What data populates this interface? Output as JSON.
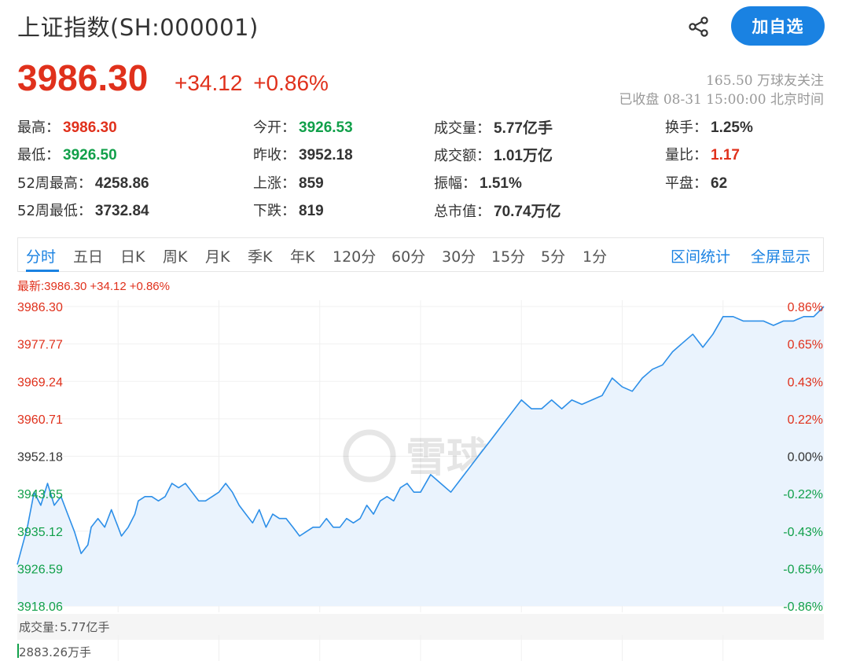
{
  "header": {
    "title": "上证指数(SH:000001)",
    "follow_button": "加自选",
    "share_icon": "share-icon"
  },
  "quote": {
    "price": "3986.30",
    "change": "+34.12",
    "change_pct": "+0.86%",
    "followers": "165.50 万球友关注",
    "status": "已收盘 08-31 15:00:00 北京时间"
  },
  "stats": [
    {
      "label": "最高：",
      "value": "3986.30",
      "color": "up"
    },
    {
      "label": "今开：",
      "value": "3926.53",
      "color": "down"
    },
    {
      "label": "成交量：",
      "value": "5.77亿手",
      "color": ""
    },
    {
      "label": "换手：",
      "value": "1.25%",
      "color": ""
    },
    {
      "label": "最低：",
      "value": "3926.50",
      "color": "down"
    },
    {
      "label": "昨收：",
      "value": "3952.18",
      "color": ""
    },
    {
      "label": "成交额：",
      "value": "1.01万亿",
      "color": ""
    },
    {
      "label": "量比：",
      "value": "1.17",
      "color": "up"
    },
    {
      "label": "52周最高：",
      "value": "4258.86",
      "color": ""
    },
    {
      "label": "上涨：",
      "value": "859",
      "color": ""
    },
    {
      "label": "振幅：",
      "value": "1.51%",
      "color": ""
    },
    {
      "label": "平盘：",
      "value": "62",
      "color": ""
    },
    {
      "label": "52周最低：",
      "value": "3732.84",
      "color": ""
    },
    {
      "label": "下跌：",
      "value": "819",
      "color": ""
    },
    {
      "label": "总市值：",
      "value": "70.74万亿",
      "color": ""
    }
  ],
  "tabs": [
    "分时",
    "五日",
    "日K",
    "周K",
    "月K",
    "季K",
    "年K",
    "120分",
    "60分",
    "30分",
    "15分",
    "5分",
    "1分"
  ],
  "tabs_right": [
    "区间统计",
    "全屏显示"
  ],
  "latest": {
    "label": "最新:3986.30",
    "change": "+34.12",
    "pct": "+0.86%"
  },
  "volume": {
    "label": "成交量:",
    "value": "5.77亿手",
    "max": "2883.26万手"
  },
  "colors": {
    "up": "#e0311c",
    "down": "#11a04a",
    "accent": "#1a82e2",
    "line": "#2d8fe8",
    "fill": "#eaf3fd"
  },
  "watermark": "雪球",
  "chart_data": {
    "type": "line",
    "prev_close": 3952.18,
    "ylim": [
      3918.06,
      3986.3
    ],
    "y_ticks_left": [
      "3986.30",
      "3977.77",
      "3969.24",
      "3960.71",
      "3952.18",
      "3943.65",
      "3935.12",
      "3926.59",
      "3918.06"
    ],
    "y_ticks_right": [
      "0.86%",
      "0.65%",
      "0.43%",
      "0.22%",
      "0.00%",
      "-0.22%",
      "-0.43%",
      "-0.65%",
      "-0.86%"
    ],
    "x_range": [
      0,
      240
    ],
    "grid": true,
    "series": [
      {
        "x": [
          0,
          3,
          5,
          7,
          9,
          11,
          13,
          15,
          17,
          19,
          21,
          22,
          24,
          26,
          28,
          30,
          31,
          33,
          35,
          36,
          38,
          40,
          42,
          44,
          46,
          48,
          50,
          52,
          54,
          56,
          58,
          60,
          62,
          64,
          66,
          68,
          70,
          72,
          74,
          76,
          78,
          80,
          82,
          84,
          86,
          88,
          90,
          92,
          94,
          96,
          98,
          100,
          102,
          104,
          106,
          108,
          110,
          112,
          114,
          116,
          118,
          120,
          123,
          126,
          129,
          132,
          135,
          138,
          141,
          144,
          147,
          150,
          153,
          156,
          159,
          162,
          165,
          168,
          171,
          174,
          177,
          180,
          183,
          186,
          189,
          192,
          195,
          198,
          201,
          204,
          207,
          210,
          213,
          216,
          219,
          222,
          225,
          228,
          231,
          234,
          237,
          240
        ],
        "y": [
          3927.5,
          3936,
          3944,
          3941,
          3946,
          3941,
          3943,
          3939,
          3935,
          3930,
          3932,
          3936,
          3938,
          3936,
          3940,
          3936,
          3934,
          3936,
          3939,
          3942,
          3943,
          3943,
          3942,
          3943,
          3946,
          3945,
          3946,
          3944,
          3942,
          3942,
          3943,
          3944,
          3946,
          3944,
          3941,
          3939,
          3937,
          3940,
          3936,
          3939,
          3938,
          3938,
          3936,
          3934,
          3935,
          3936,
          3936,
          3938,
          3936,
          3936,
          3938,
          3937,
          3938,
          3941,
          3939,
          3942,
          3943,
          3942,
          3945,
          3946,
          3944,
          3944,
          3948,
          3946,
          3944,
          3947,
          3950,
          3953,
          3956,
          3959,
          3962,
          3965,
          3963,
          3963,
          3965,
          3963,
          3965,
          3964,
          3965,
          3966,
          3970,
          3968,
          3967,
          3970,
          3972,
          3973,
          3976,
          3978,
          3980,
          3977,
          3980,
          3984,
          3984,
          3983,
          3983,
          3983,
          3982,
          3983,
          3983,
          3984,
          3984,
          3986.3
        ]
      }
    ]
  }
}
